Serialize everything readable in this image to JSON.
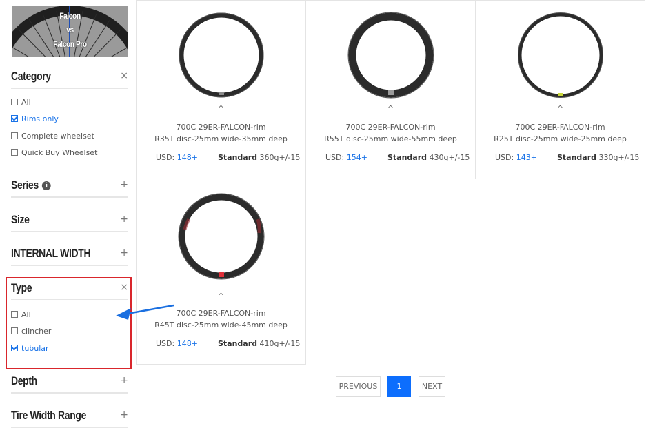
{
  "banner": {
    "line1": "Falcon",
    "line2": "vs",
    "line3": "Falcon Pro"
  },
  "filters": {
    "category": {
      "title": "Category",
      "toggle": "×",
      "options": [
        {
          "label": "All",
          "checked": false
        },
        {
          "label": "Rims only",
          "checked": true
        },
        {
          "label": "Complete wheelset",
          "checked": false
        },
        {
          "label": "Quick Buy Wheelset",
          "checked": false
        }
      ]
    },
    "series": {
      "title": "Series",
      "toggle": "+",
      "info_icon": "info-circle-icon",
      "info_glyph": "i"
    },
    "size": {
      "title": "Size",
      "toggle": "+"
    },
    "internal_width": {
      "title": "INTERNAL WIDTH",
      "toggle": "+"
    },
    "type": {
      "title": "Type",
      "toggle": "×",
      "options": [
        {
          "label": "All",
          "checked": false
        },
        {
          "label": "clincher",
          "checked": false
        },
        {
          "label": "tubular",
          "checked": true
        }
      ]
    },
    "depth": {
      "title": "Depth",
      "toggle": "+"
    },
    "tire_width_range": {
      "title": "Tire Width Range",
      "toggle": "+"
    }
  },
  "products": [
    {
      "caret": "^",
      "title_line1": "700C 29ER-FALCON-rim",
      "title_line2": "R35T disc-25mm wide-35mm deep",
      "price_label": "USD:",
      "price": "148+",
      "weight_label": "Standard",
      "weight": "360g+/-15",
      "accent_color": "#8a8a8a"
    },
    {
      "caret": "^",
      "title_line1": "700C 29ER-FALCON-rim",
      "title_line2": "R55T disc-25mm wide-55mm deep",
      "price_label": "USD:",
      "price": "154+",
      "weight_label": "Standard",
      "weight": "430g+/-15",
      "accent_color": "#9a9a9a"
    },
    {
      "caret": "^",
      "title_line1": "700C 29ER-FALCON-rim",
      "title_line2": "R25T disc-25mm wide-25mm deep",
      "price_label": "USD:",
      "price": "143+",
      "weight_label": "Standard",
      "weight": "330g+/-15",
      "accent_color": "#c8d63a"
    },
    {
      "caret": "^",
      "title_line1": "700C 29ER-FALCON-rim",
      "title_line2": "R45T disc-25mm wide-45mm deep",
      "price_label": "USD:",
      "price": "148+",
      "weight_label": "Standard",
      "weight": "410g+/-15",
      "accent_color": "#e0303a"
    }
  ],
  "pagination": {
    "previous": "PREVIOUS",
    "current": "1",
    "next": "NEXT"
  },
  "colors": {
    "link_blue": "#1a73e8",
    "highlight_red": "#d9262c",
    "arrow_blue": "#1a6fe0",
    "page_active": "#0d6efd"
  }
}
